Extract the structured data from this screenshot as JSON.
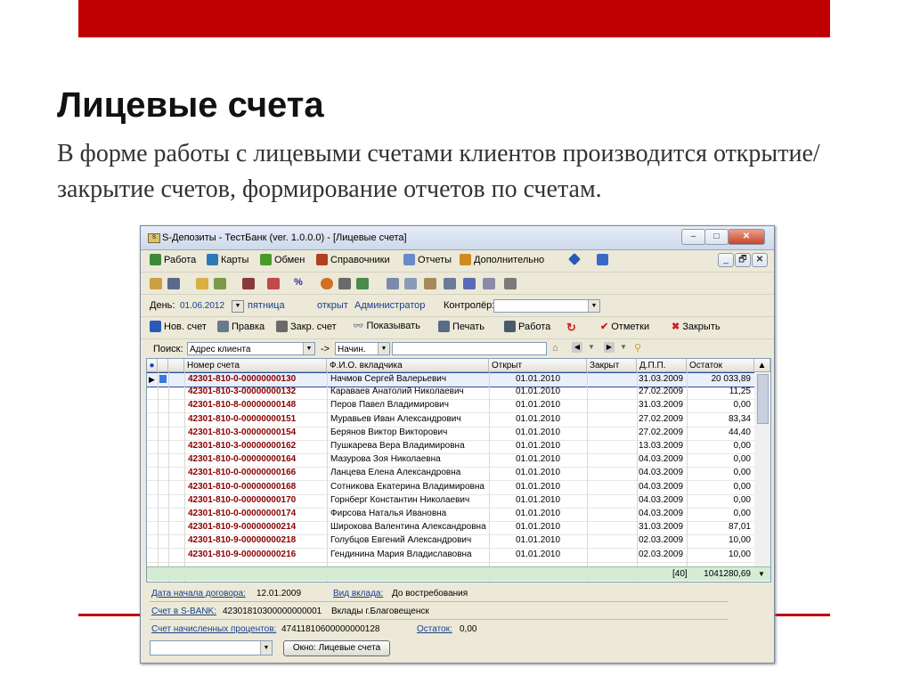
{
  "slide": {
    "title": "Лицевые счета",
    "subtitle": "В форме работы с лицевыми счетами клиентов производится открытие/закрытие счетов, формирование отчетов по счетам."
  },
  "window": {
    "title": "S-Депозиты - ТестБанк (ver. 1.0.0.0) - [Лицевые счета]",
    "min": "–",
    "max": "□",
    "close": "✕",
    "mdi_min": "_",
    "mdi_restore": "🗗",
    "mdi_close": "✕"
  },
  "menu": [
    "Работа",
    "Карты",
    "Обмен",
    "Справочники",
    "Отчеты",
    "Дополнительно"
  ],
  "filter": {
    "day_label": "День:",
    "day_value": "01.06.2012",
    "weekday": "пятница",
    "status": "открыт",
    "user": "Администратор",
    "controller_label": "Контролёр:",
    "controller_value": ""
  },
  "actions": {
    "new": "Нов. счет",
    "edit": "Правка",
    "close_acc": "Закр. счет",
    "show": "Показывать",
    "print": "Печать",
    "work": "Работа",
    "marks": "Отметки",
    "close": "Закрыть"
  },
  "search": {
    "label": "Поиск:",
    "field": "Адрес клиента",
    "arrow": "->",
    "mode": "Начин.",
    "value": ""
  },
  "table": {
    "headers": [
      "Номер счета",
      "Ф.И.О. вкладчика",
      "Открыт",
      "Закрыт",
      "Д.П.П.",
      "Остаток"
    ],
    "rows": [
      [
        "42301-810-0-00000000130",
        "Начмов Сергей Валерьевич",
        "01.01.2010",
        "",
        "31.03.2009",
        "20 033,89"
      ],
      [
        "42301-810-3-00000000132",
        "Караваев Анатолий Николаевич",
        "01.01.2010",
        "",
        "27.02.2009",
        "11,25"
      ],
      [
        "42301-810-8-00000000148",
        "Перов Павел Владимирович",
        "01.01.2010",
        "",
        "31.03.2009",
        "0,00"
      ],
      [
        "42301-810-0-00000000151",
        "Муравьев Иван Александрович",
        "01.01.2010",
        "",
        "27.02.2009",
        "83,34"
      ],
      [
        "42301-810-3-00000000154",
        "Берянов Виктор Викторович",
        "01.01.2010",
        "",
        "27.02.2009",
        "44,40"
      ],
      [
        "42301-810-3-00000000162",
        "Пушкарева Вера Владимировна",
        "01.01.2010",
        "",
        "13.03.2009",
        "0,00"
      ],
      [
        "42301-810-0-00000000164",
        "Мазурова Зоя Николаевна",
        "01.01.2010",
        "",
        "04.03.2009",
        "0,00"
      ],
      [
        "42301-810-0-00000000166",
        "Ланцева Елена Александровна",
        "01.01.2010",
        "",
        "04.03.2009",
        "0,00"
      ],
      [
        "42301-810-0-00000000168",
        "Сотникова Екатерина Владимировна",
        "01.01.2010",
        "",
        "04.03.2009",
        "0,00"
      ],
      [
        "42301-810-0-00000000170",
        "Горнберг Константин Николаевич",
        "01.01.2010",
        "",
        "04.03.2009",
        "0,00"
      ],
      [
        "42301-810-0-00000000174",
        "Фирсова Наталья Ивановна",
        "01.01.2010",
        "",
        "04.03.2009",
        "0,00"
      ],
      [
        "42301-810-9-00000000214",
        "Широкова Валентина Александровна",
        "01.01.2010",
        "",
        "31.03.2009",
        "87,01"
      ],
      [
        "42301-810-9-00000000218",
        "Голубцов Евгений Александрович",
        "01.01.2010",
        "",
        "02.03.2009",
        "10,00"
      ],
      [
        "42301-810-9-00000000216",
        "Гендинина Мария Владиславовна",
        "01.01.2010",
        "",
        "02.03.2009",
        "10,00"
      ]
    ],
    "footer_count": "[40]",
    "footer_total": "1041280,69"
  },
  "details": {
    "contract_date_label": "Дата начала договора:",
    "contract_date": "12.01.2009",
    "deposit_type_label": "Вид вклада:",
    "deposit_type": "До востребования",
    "sbank_label": "Счет в S-BANK:",
    "sbank_account": "42301810300000000001",
    "branch": "Вклады г.Благовещенск",
    "interest_label": "Счет начисленных процентов:",
    "interest_account": "47411810600000000128",
    "balance_label": "Остаток:",
    "balance": "0,00"
  },
  "bottom": {
    "combo": "",
    "window_button": "Окно: Лицевые счета"
  },
  "colors": {
    "accent_red": "#c00000",
    "account_text": "#8b0000",
    "link_blue": "#1a3e8c",
    "footer_green": "#d4ecd4"
  }
}
